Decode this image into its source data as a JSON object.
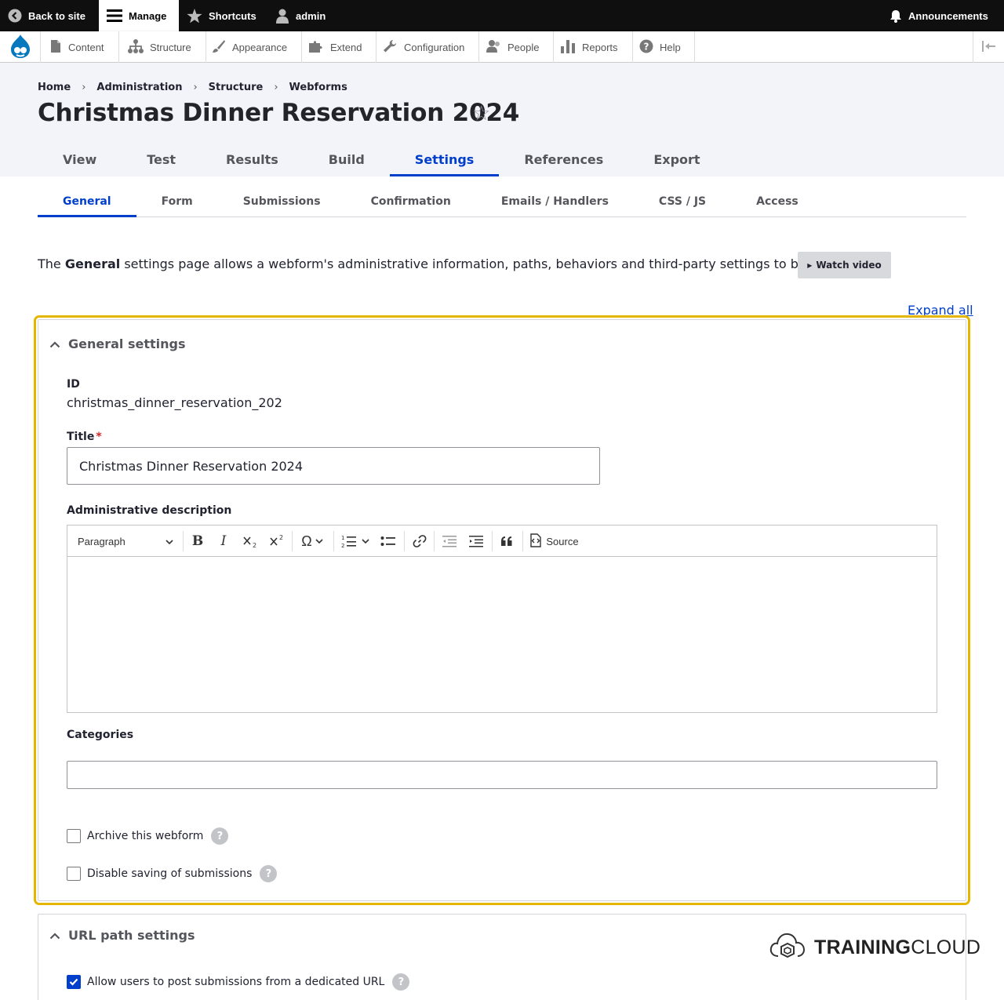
{
  "toolbar": {
    "back_to_site": "Back to site",
    "manage": "Manage",
    "shortcuts": "Shortcuts",
    "user": "admin",
    "announcements": "Announcements"
  },
  "tray": {
    "items": [
      "Content",
      "Structure",
      "Appearance",
      "Extend",
      "Configuration",
      "People",
      "Reports",
      "Help"
    ]
  },
  "breadcrumb": [
    "Home",
    "Administration",
    "Structure",
    "Webforms"
  ],
  "page_title": "Christmas Dinner Reservation 2024",
  "primary_tabs": [
    "View",
    "Test",
    "Results",
    "Build",
    "Settings",
    "References",
    "Export"
  ],
  "primary_active": "Settings",
  "secondary_tabs": [
    "General",
    "Form",
    "Submissions",
    "Confirmation",
    "Emails / Handlers",
    "CSS / JS",
    "Access"
  ],
  "secondary_active": "General",
  "intro": {
    "prefix": "The ",
    "bold": "General",
    "suffix": " settings page allows a webform's administrative information, paths, behaviors and third-party settings to be customized."
  },
  "watch_video": "Watch video",
  "expand_all": "Expand all",
  "general_settings": {
    "title": "General settings",
    "id_label": "ID",
    "id_value": "christmas_dinner_reservation_202",
    "title_label": "Title",
    "title_required_mark": "*",
    "title_value": "Christmas Dinner Reservation 2024",
    "admin_desc_label": "Administrative description",
    "editor": {
      "paragraph_select": "Paragraph",
      "source": "Source"
    },
    "categories_label": "Categories",
    "categories_value": "",
    "archive_label": "Archive this webform",
    "disable_saving_label": "Disable saving of submissions",
    "help_glyph": "?"
  },
  "url_path_settings": {
    "title": "URL path settings",
    "allow_post_label": "Allow users to post submissions from a dedicated URL",
    "allow_post_checked": true
  },
  "watermark": {
    "bold": "TRAINING",
    "normal": "CLOUD"
  },
  "colors": {
    "accent": "#003ecc",
    "focus_outline": "#e4b600",
    "toolbar_bg": "#0f0f0f",
    "header_bg": "#f3f4f9",
    "drupal_blue": "#0678be"
  }
}
